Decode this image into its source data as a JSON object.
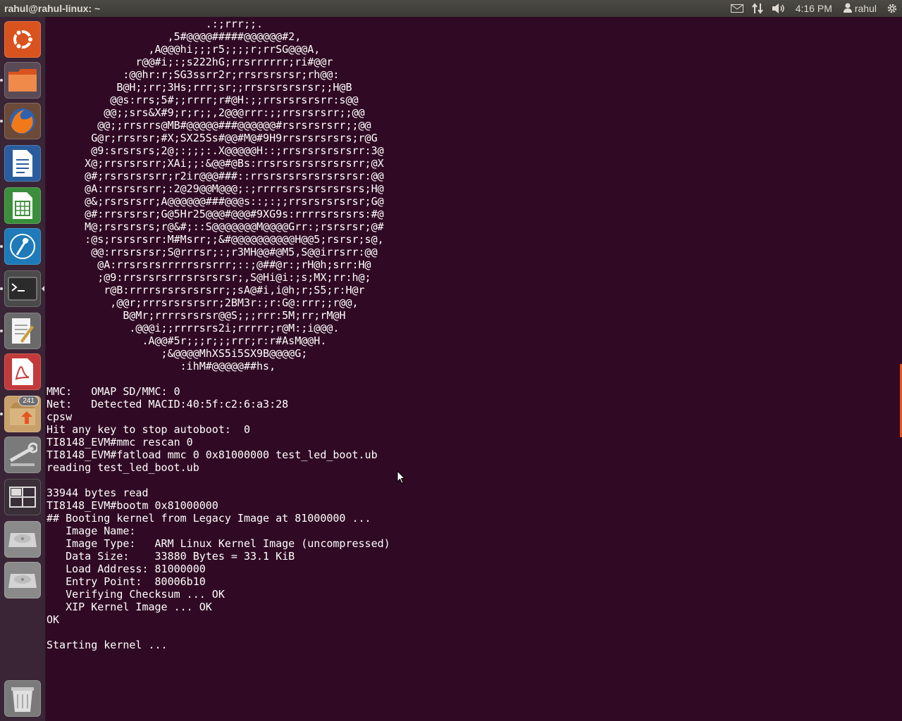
{
  "top_panel": {
    "window_title": "rahul@rahul-linux: ~",
    "clock": "4:16 PM",
    "user": "rahul",
    "icons": [
      "mail-icon",
      "network-icon",
      "volume-icon",
      "user-icon",
      "gear-icon"
    ]
  },
  "launcher": {
    "items": [
      {
        "name": "ubuntu-dash-icon"
      },
      {
        "name": "files-icon"
      },
      {
        "name": "firefox-icon"
      },
      {
        "name": "writer-icon"
      },
      {
        "name": "calc-icon"
      },
      {
        "name": "impress-icon"
      },
      {
        "name": "terminal-icon"
      },
      {
        "name": "text-editor-icon"
      },
      {
        "name": "pdf-viewer-icon"
      },
      {
        "name": "software-updater-icon",
        "badge": "241"
      },
      {
        "name": "system-settings-icon"
      },
      {
        "name": "workspace-switcher-icon"
      },
      {
        "name": "drive-icon"
      },
      {
        "name": "drive-icon"
      },
      {
        "name": "trash-icon"
      }
    ]
  },
  "terminal": {
    "lines": [
      "                         .:;rrr;;.",
      "                   ,5#@@@@#####@@@@@@#2,",
      "                ,A@@@hi;;;r5;;;;r;rrSG@@@A,",
      "              r@@#i;:;s222hG;rrsrrrrrr;ri#@@r",
      "            :@@hr:r;SG3ssrr2r;rrsrsrsrsr;rh@@:",
      "           B@H;;rr;3Hs;rrr;sr;;rrsrsrsrsrsr;;H@B",
      "          @@s:rrs;5#;;rrrr;r#@H:;;rrsrsrsrsrr:s@@",
      "         @@;;srs&X#9;r;r;;,2@@@rrr:;;rrsrsrsrr;;@@",
      "        @@;;rrsrrs@MB#@@@@@###@@@@@@#rsrsrsrsrr;;@@",
      "       G@r;rrsrsr;#X;SX25Ss#@@#M@#9H9rrsrsrsrsrs;r@G",
      "       @9:srsrsrs;2@;:;;;:.X@@@@@H::;rrsrsrsrsrsrr:3@",
      "      X@;rrsrsrsrr;XAi;;:&@@#@Bs:rrsrsrsrsrsrsrsrr;@X",
      "      @#;rsrsrsrsrr;r2ir@@@###::rrsrsrsrsrsrsrsrsr:@@",
      "      @A:rrsrsrsrr;:2@29@@M@@@;:;rrrrsrsrsrsrsrsrs;H@",
      "      @&;rsrsrsrr;A@@@@@@###@@@s::;:;;rrsrsrsrsrsr;G@",
      "      @#:rrsrsrsr;G@5Hr25@@@#@@@#9XG9s:rrrrsrsrsrs:#@",
      "      M@;rsrsrsrs;r@&#;::S@@@@@@@M@@@@Grr:;rsrsrsr;@#",
      "      :@s;rsrsrsrr:M#Msrr;;&#@@@@@@@@@@H@@5;rsrsr;s@,",
      "       @@:rrsrsrsr;S@rrrsr;:;r3MH@@#@M5,S@@irrsrr:@@",
      "        @A:rrsrsrsrrrrrsrsrrr;::;@##@r:;rH@h;srr:H@",
      "        ;@9:rrsrsrsrrrsrsrsrsr;,S@Hi@i:;s;MX;rr:h@;",
      "         r@B:rrrrsrsrsrsrsrr;;sA@#i,i@h;r;S5;r:H@r",
      "          ,@@r;rrrsrsrsrsrr;2BM3r:;r:G@:rrr;;r@@,",
      "            B@Mr;rrrrsrsrsr@@S;;;rrr:5M;rr;rM@H",
      "             .@@@i;;rrrrsrs2i;rrrrr;r@M:;i@@@.",
      "               .A@@#5r;;;r;;;rrr;r:r#AsM@@H.",
      "                  ;&@@@@MhXS5i5SX9B@@@@G;",
      "                     :ihM#@@@@@##hs,",
      "",
      "MMC:   OMAP SD/MMC: 0",
      "Net:   Detected MACID:40:5f:c2:6:a3:28",
      "cpsw",
      "Hit any key to stop autoboot:  0",
      "TI8148_EVM#mmc rescan 0",
      "TI8148_EVM#fatload mmc 0 0x81000000 test_led_boot.ub",
      "reading test_led_boot.ub",
      "",
      "33944 bytes read",
      "TI8148_EVM#bootm 0x81000000",
      "## Booting kernel from Legacy Image at 81000000 ...",
      "   Image Name:",
      "   Image Type:   ARM Linux Kernel Image (uncompressed)",
      "   Data Size:    33880 Bytes = 33.1 KiB",
      "   Load Address: 81000000",
      "   Entry Point:  80006b10",
      "   Verifying Checksum ... OK",
      "   XIP Kernel Image ... OK",
      "OK",
      "",
      "Starting kernel ..."
    ]
  }
}
